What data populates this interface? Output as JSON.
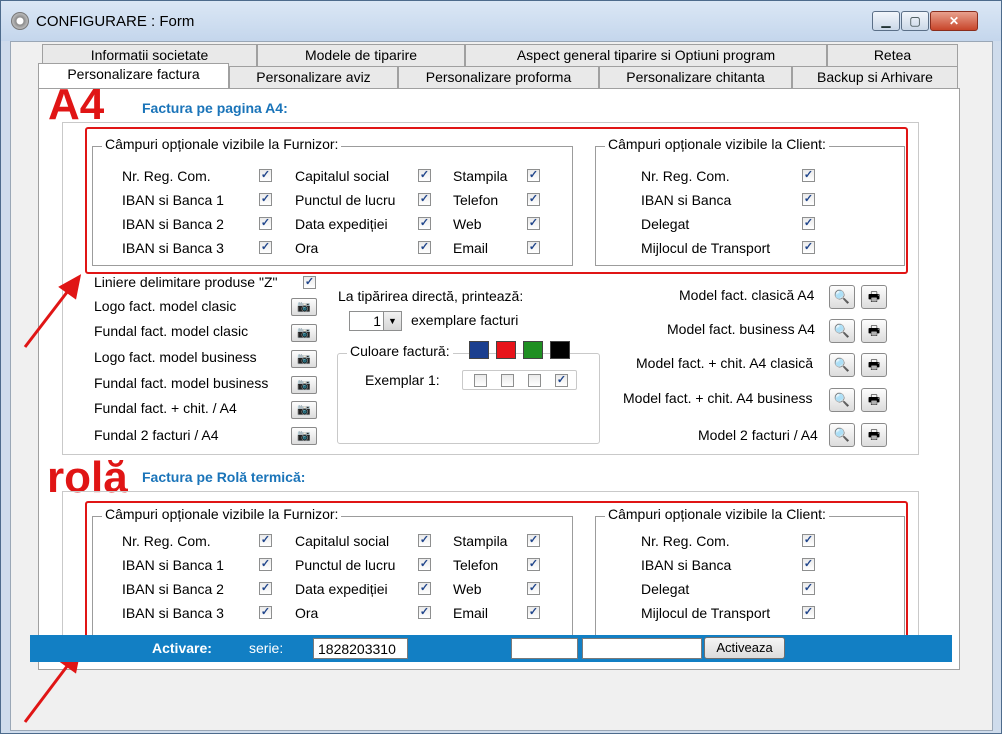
{
  "window": {
    "title": "CONFIGURARE : Form",
    "minimize": "▁",
    "maximize": "▢",
    "close": "✕"
  },
  "tabs_row1": [
    "Informatii societate",
    "Modele de tiparire",
    "Aspect general tiparire si Optiuni program",
    "Retea"
  ],
  "tabs_row2": [
    "Personalizare factura",
    "Personalizare aviz",
    "Personalizare proforma",
    "Personalizare chitanta",
    "Backup si Arhivare"
  ],
  "annotations": {
    "a4": "A4",
    "rola": "rolă",
    "arrow_color": "#e01515"
  },
  "a4": {
    "section_title": "Factura pe pagina A4:",
    "furnizor_legend": "Câmpuri opționale vizibile la Furnizor:",
    "client_legend": "Câmpuri opționale vizibile la Client:",
    "furnizor_fields": [
      [
        "Nr. Reg. Com.",
        "IBAN si Banca 1",
        "IBAN si Banca 2",
        "IBAN si Banca 3"
      ],
      [
        "Capitalul social",
        "Punctul de lucru",
        "Data expediției",
        "Ora"
      ],
      [
        "Stampila",
        "Telefon",
        "Web",
        "Email"
      ]
    ],
    "client_fields": [
      "Nr. Reg. Com.",
      "IBAN si Banca",
      "Delegat",
      "Mijlocul de Transport"
    ],
    "check_mark": "✓",
    "liniere": "Liniere delimitare produse \"Z\"",
    "images": [
      "Logo fact. model clasic",
      "Fundal fact. model clasic",
      "Logo fact. model business",
      "Fundal fact. model business",
      "Fundal fact. + chit. / A4",
      "Fundal 2 facturi / A4"
    ],
    "camera_icon": "📷",
    "print_direct_label": "La tipărirea directă, printează:",
    "copies_value": "1",
    "copies_arrow": "▼",
    "copies_label": "exemplare facturi",
    "color_legend": "Culoare factură:",
    "colors": [
      "#1b3f8f",
      "#e8131a",
      "#1f8f22",
      "#000000"
    ],
    "exemplar_label": "Exemplar 1:",
    "exemplar_checks": [
      false,
      false,
      false,
      true
    ],
    "models": [
      "Model fact. clasică A4",
      "Model fact. business A4",
      "Model fact. + chit. A4 clasică",
      "Model fact. + chit. A4 business",
      "Model 2 facturi / A4"
    ],
    "preview_icon": "🔍",
    "print_icon": "🖶"
  },
  "rola": {
    "section_title": "Factura pe Rolă termică:",
    "furnizor_legend": "Câmpuri opționale vizibile la Furnizor:",
    "client_legend": "Câmpuri opționale vizibile la Client:",
    "furnizor_fields": [
      [
        "Nr. Reg. Com.",
        "IBAN si Banca 1",
        "IBAN si Banca 2",
        "IBAN si Banca 3"
      ],
      [
        "Capitalul social",
        "Punctul de lucru",
        "Data expediției",
        "Ora"
      ],
      [
        "Stampila",
        "Telefon",
        "Web",
        "Email"
      ]
    ],
    "client_fields": [
      "Nr. Reg. Com.",
      "IBAN si Banca",
      "Delegat",
      "Mijlocul de Transport"
    ]
  },
  "activation": {
    "title": "Activare:",
    "serie_label": "serie:",
    "serie_value": "1828203310",
    "field2": "",
    "field3": "",
    "button": "Activeaza"
  }
}
